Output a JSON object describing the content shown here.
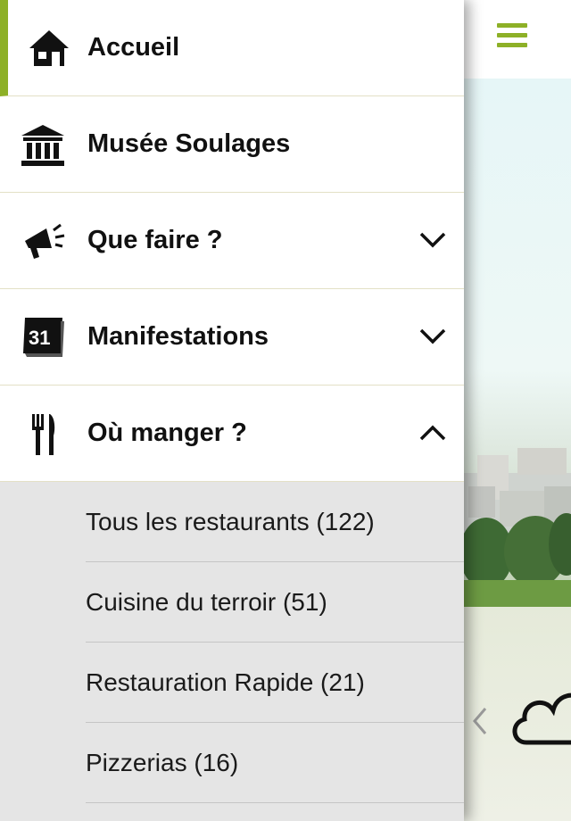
{
  "menu": {
    "items": [
      {
        "label": "Accueil",
        "icon": "home-icon",
        "active": true
      },
      {
        "label": "Musée Soulages",
        "icon": "museum-icon"
      },
      {
        "label": "Que faire ?",
        "icon": "megaphone-icon",
        "expandable": true,
        "expanded": false
      },
      {
        "label": "Manifestations",
        "icon": "calendar-icon",
        "icon_text": "31",
        "expandable": true,
        "expanded": false
      },
      {
        "label": "Où manger ?",
        "icon": "cutlery-icon",
        "expandable": true,
        "expanded": true
      }
    ],
    "submenu": [
      {
        "label": "Tous les restaurants (122)"
      },
      {
        "label": "Cuisine du terroir (51)"
      },
      {
        "label": "Restauration Rapide (21)"
      },
      {
        "label": "Pizzerias (16)"
      }
    ]
  },
  "header": {
    "menu_icon": "hamburger-icon"
  },
  "colors": {
    "accent": "#8db027",
    "divider": "#e3e0c6",
    "submenu_bg": "#e5e5e5"
  }
}
